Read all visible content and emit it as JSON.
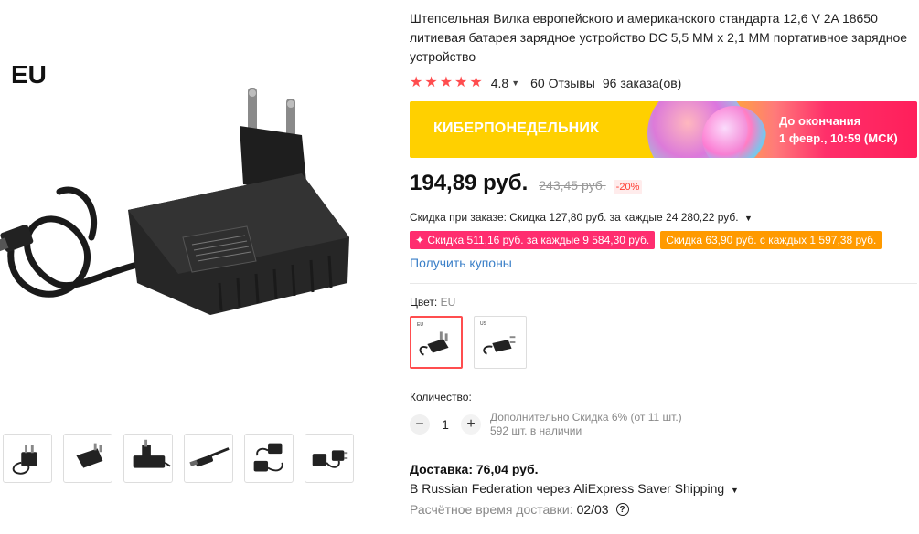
{
  "gallery": {
    "main_label": "EU",
    "thumb_icons": [
      "adapter-eu-icon",
      "adapter-side-icon",
      "adapter-back-icon",
      "dc-plug-icon",
      "adapter-pair-icon",
      "adapter-us-icon"
    ]
  },
  "product": {
    "title": "Штепсельная Вилка европейского и американского стандарта 12,6 V 2A 18650 литиевая батарея зарядное устройство DC 5,5 MM x 2,1 MM портативное зарядное устройство",
    "rating": "4.8",
    "reviews": "60 Отзывы",
    "orders": "96 заказа(ов)"
  },
  "promo": {
    "title": "КИБЕРПОНЕДЕЛЬНИК",
    "until_label": "До окончания",
    "until_value": "1 февр., 10:59 (МСК)"
  },
  "price": {
    "current": "194,89 руб.",
    "old": "243,45 руб.",
    "discount": "-20%"
  },
  "discounts": {
    "order_discount": "Скидка при заказе: Скидка 127,80 руб. за каждые 24 280,22 руб.",
    "chip_pink": "✦ Скидка 511,16 руб. за каждые 9 584,30 руб.",
    "chip_orange": "Скидка 63,90 руб. с каждых 1 597,38 руб.",
    "coupons": "Получить купоны"
  },
  "color": {
    "label": "Цвет:",
    "value": "EU",
    "options": [
      "EU",
      "US"
    ]
  },
  "quantity": {
    "label": "Количество:",
    "value": "1",
    "minus": "−",
    "plus": "+",
    "extra_discount": "Дополнительно Скидка 6% (от 11 шт.)",
    "stock": "592 шт. в наличии"
  },
  "delivery": {
    "cost": "Доставка: 76,04 руб.",
    "method": "В Russian Federation через AliExpress Saver Shipping",
    "estimate_label": "Расчётное время доставки:",
    "estimate_date": "02/03"
  },
  "colors": {
    "accent": "#ff4d4f",
    "link": "#3a7fc8",
    "chip_pink": "#ff2d6f",
    "chip_orange": "#ff9a00",
    "promo_yellow": "#ffd000"
  }
}
